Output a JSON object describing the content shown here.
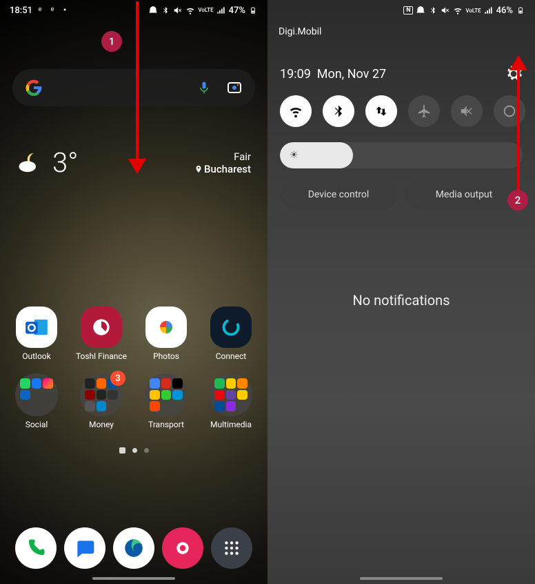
{
  "annotation": {
    "marker1": "1",
    "marker2": "2"
  },
  "home": {
    "statusbar": {
      "time": "18:51",
      "battery": "47%",
      "volte": "VoLTE"
    },
    "weather": {
      "temp": "3°",
      "condition": "Fair",
      "location": "Bucharest"
    },
    "apps": [
      {
        "label": "Outlook"
      },
      {
        "label": "Toshl Finance"
      },
      {
        "label": "Photos"
      },
      {
        "label": "Connect"
      }
    ],
    "folders": [
      {
        "label": "Social"
      },
      {
        "label": "Money",
        "badge": "3"
      },
      {
        "label": "Transport"
      },
      {
        "label": "Multimedia"
      }
    ]
  },
  "panel": {
    "carrier": "Digi.Mobil",
    "statusbar": {
      "battery": "46%",
      "volte": "VoLTE"
    },
    "time": "19:09",
    "date": "Mon, Nov 27",
    "buttons": {
      "device": "Device control",
      "media": "Media output"
    },
    "empty": "No notifications"
  },
  "colors": {
    "accent": "#ad1d44",
    "arrow": "#e20000",
    "badge": "#ff4d2e"
  }
}
